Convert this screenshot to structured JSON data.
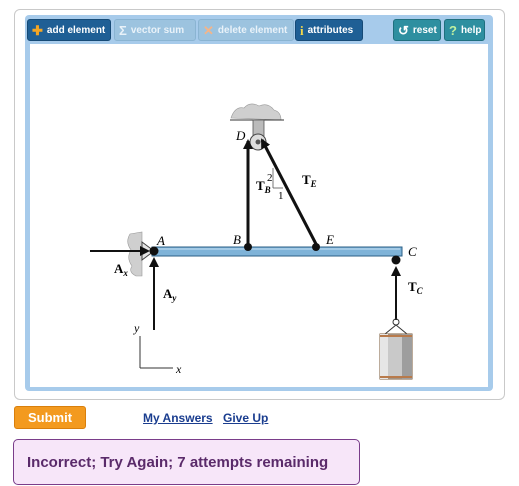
{
  "toolbar": {
    "add_element": "add element",
    "vector_sum": "vector sum",
    "delete_element": "delete element",
    "attributes": "attributes",
    "reset": "reset",
    "help": "help"
  },
  "diagram": {
    "points": {
      "A": "A",
      "B": "B",
      "C": "C",
      "D": "D",
      "E": "E"
    },
    "forces": {
      "ax": "A",
      "ax_sub": "x",
      "ay": "A",
      "ay_sub": "y",
      "tb": "T",
      "tb_sub": "B",
      "te": "T",
      "te_sub": "E",
      "tc": "T",
      "tc_sub": "C"
    },
    "slope": {
      "rise": "2",
      "run": "1"
    },
    "axes": {
      "x": "x",
      "y": "y"
    },
    "colors": {
      "beam": "#7fb3d8",
      "weight": "#c9c9c9",
      "support": "#cfcfcf"
    }
  },
  "actions": {
    "submit": "Submit",
    "my_answers": "My Answers",
    "give_up": "Give Up"
  },
  "feedback": {
    "message": "Incorrect; Try Again; 7 attempts remaining"
  }
}
